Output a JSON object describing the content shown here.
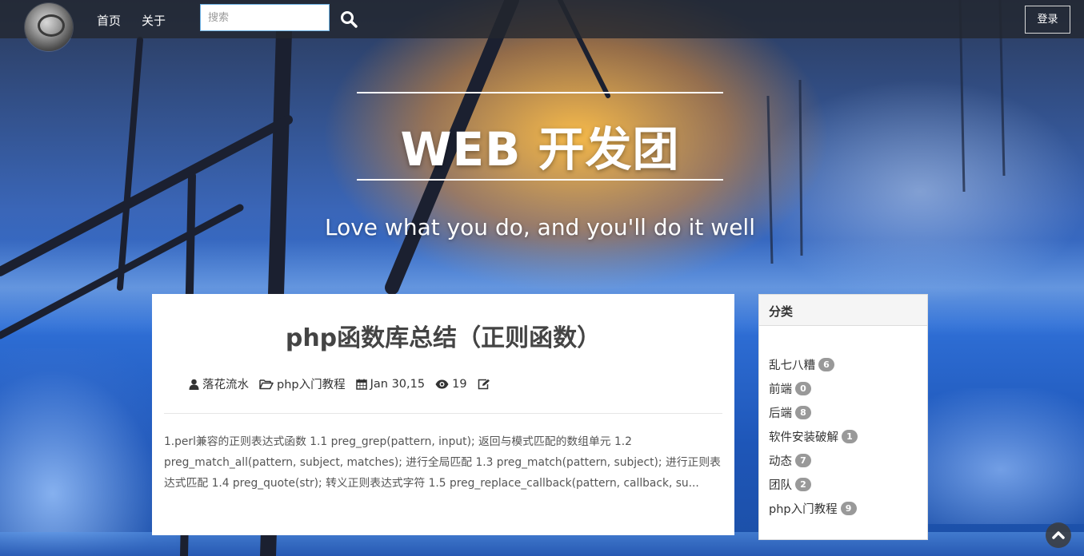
{
  "nav": {
    "home_label": "首页",
    "about_label": "关于",
    "search_placeholder": "搜索",
    "login_label": "登录"
  },
  "hero": {
    "title": "WEB 开发团",
    "subtitle": "Love what you do, and you'll do it well"
  },
  "post": {
    "title": "php函数库总结（正则函数）",
    "author": "落花流水",
    "category": "php入门教程",
    "date": "Jan 30,15",
    "views": "19",
    "excerpt": "1.perl兼容的正则表达式函数 1.1 preg_grep(pattern, input); 返回与模式匹配的数组单元 1.2 preg_match_all(pattern, subject, matches); 进行全局匹配 1.3 preg_match(pattern, subject); 进行正则表达式匹配 1.4 preg_quote(str); 转义正则表达式字符 1.5 preg_replace_callback(pattern, callback, su..."
  },
  "sidebar": {
    "title": "分类",
    "categories": [
      {
        "name": "乱七八糟",
        "count": "6"
      },
      {
        "name": "前端",
        "count": "0"
      },
      {
        "name": "后端",
        "count": "8"
      },
      {
        "name": "软件安装破解",
        "count": "1"
      },
      {
        "name": "动态",
        "count": "7"
      },
      {
        "name": "团队",
        "count": "2"
      },
      {
        "name": "php入门教程",
        "count": "9"
      }
    ]
  },
  "icons": {
    "search": "search-icon",
    "author": "user-icon",
    "category": "folder-open-icon",
    "date": "calendar-icon",
    "views": "eye-icon",
    "edit": "edit-icon",
    "back_to_top": "chevron-up-icon"
  },
  "colors": {
    "navbar_bg": "#22262e",
    "badge": "#999999",
    "search_border": "#6fb3e6"
  }
}
